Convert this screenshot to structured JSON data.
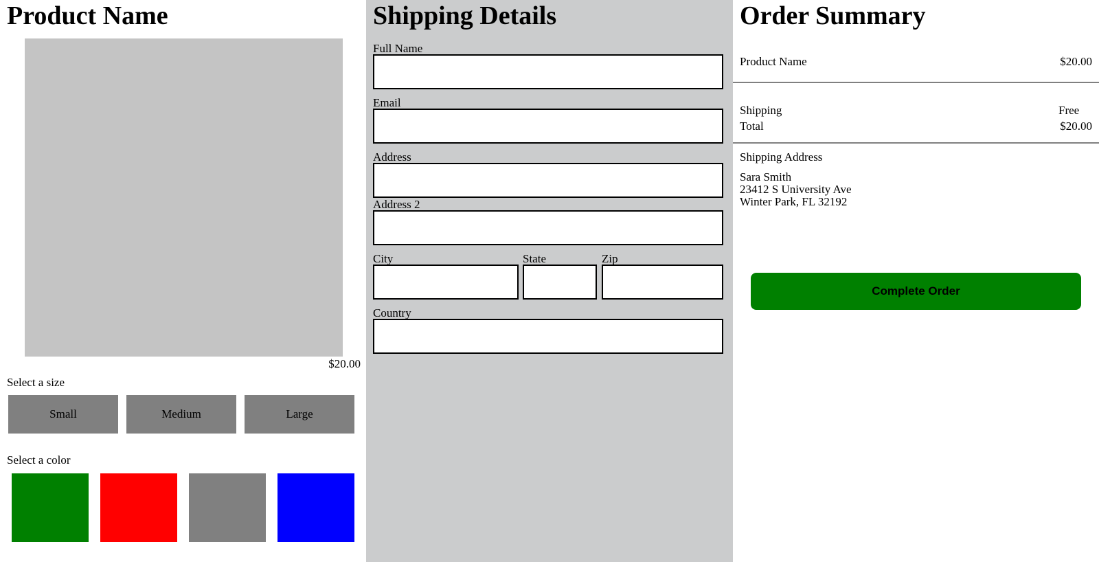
{
  "product": {
    "title": "Product Name",
    "price": "$20.00",
    "size_label": "Select a size",
    "sizes": [
      "Small",
      "Medium",
      "Large"
    ],
    "color_label": "Select a color",
    "colors": [
      "#008000",
      "#ff0000",
      "#808080",
      "#0000ff"
    ]
  },
  "shipping": {
    "title": "Shipping Details",
    "fields": {
      "full_name": {
        "label": "Full Name",
        "value": ""
      },
      "email": {
        "label": "Email",
        "value": ""
      },
      "address": {
        "label": "Address",
        "value": ""
      },
      "address2": {
        "label": "Address 2",
        "value": ""
      },
      "city": {
        "label": "City",
        "value": ""
      },
      "state": {
        "label": "State",
        "value": ""
      },
      "zip": {
        "label": "Zip",
        "value": ""
      },
      "country": {
        "label": "Country",
        "value": ""
      }
    }
  },
  "summary": {
    "title": "Order Summary",
    "item_name": "Product Name",
    "item_price": "$20.00",
    "shipping_label": "Shipping",
    "shipping_value": "Free",
    "total_label": "Total",
    "total_value": "$20.00",
    "address_heading": "Shipping Address",
    "address_lines": [
      "Sara Smith",
      "23412 S University Ave",
      "Winter Park, FL 32192"
    ],
    "complete_button": "Complete Order"
  },
  "theme": {
    "shipping_panel_bg": "#cbcccd",
    "image_placeholder": "#c4c4c4",
    "size_button_bg": "#808080",
    "complete_button_bg": "#008000"
  }
}
